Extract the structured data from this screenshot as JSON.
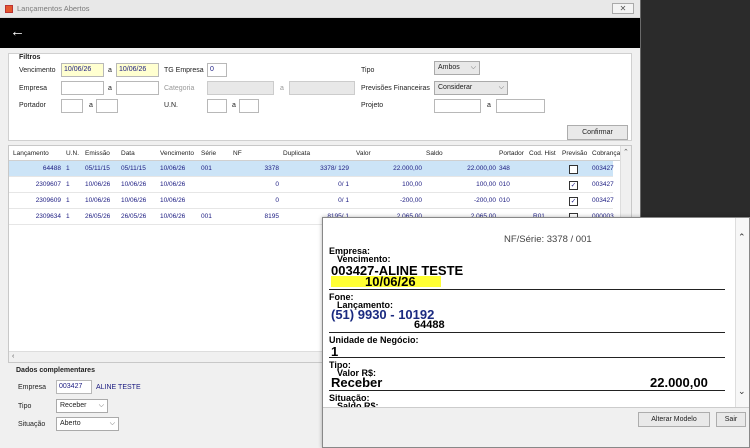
{
  "window": {
    "title": "Lançamentos Abertos"
  },
  "header": {
    "back_icon": "←"
  },
  "filters": {
    "group_title": "Filtros",
    "vencimento_label": "Vencimento",
    "vencimento_from": "10/06/26",
    "a": "a",
    "vencimento_to": "10/06/26",
    "tg_empresa_label": "TG Empresa",
    "tg_empresa_value": "0",
    "tipo_label": "Tipo",
    "tipo_value": "Ambos",
    "empresa_label": "Empresa",
    "categoria_label": "Categoria",
    "previsoes_label": "Previsões Financeiras",
    "previsoes_value": "Considerar",
    "portador_label": "Portador",
    "un_label": "U.N.",
    "projeto_label": "Projeto",
    "confirm_button": "Confirmar"
  },
  "grid": {
    "columns": [
      "Lançamento",
      "U.N.",
      "Emissão",
      "Data",
      "Vencimento",
      "Série",
      "NF",
      "Duplicata",
      "Valor",
      "Saldo",
      "Portador",
      "Cod. Hist",
      "Previsão",
      "Cobrança"
    ],
    "rows": [
      {
        "lancamento": "64488",
        "un": "1",
        "emissao": "05/11/15",
        "data": "05/11/15",
        "vencimento": "10/06/26",
        "serie": "001",
        "nf": "3378",
        "duplicata": "3378/ 129",
        "valor": "22.000,00",
        "saldo": "22.000,00",
        "portador": "348",
        "codhist": "",
        "previsao": "",
        "cobranca": "003427"
      },
      {
        "lancamento": "2309607",
        "un": "1",
        "emissao": "10/06/26",
        "data": "10/06/26",
        "vencimento": "10/06/26",
        "serie": "",
        "nf": "0",
        "duplicata": "0/ 1",
        "valor": "100,00",
        "saldo": "100,00",
        "portador": "010",
        "codhist": "",
        "previsao": "✓",
        "cobranca": "003427"
      },
      {
        "lancamento": "2309609",
        "un": "1",
        "emissao": "10/06/26",
        "data": "10/06/26",
        "vencimento": "10/06/26",
        "serie": "",
        "nf": "0",
        "duplicata": "0/ 1",
        "valor": "-200,00",
        "saldo": "-200,00",
        "portador": "010",
        "codhist": "",
        "previsao": "✓",
        "cobranca": "003427"
      },
      {
        "lancamento": "2309634",
        "un": "1",
        "emissao": "26/05/26",
        "data": "26/05/26",
        "vencimento": "10/06/26",
        "serie": "001",
        "nf": "8195",
        "duplicata": "8195/ 1",
        "valor": "2.065,00",
        "saldo": "2.065,00",
        "portador": "",
        "codhist": "R01",
        "previsao": "",
        "cobranca": "000003"
      }
    ]
  },
  "dados": {
    "group_title": "Dados complementares",
    "empresa_label": "Empresa",
    "empresa_code": "003427",
    "empresa_name": "ALINE TESTE",
    "tipo_label": "Tipo",
    "tipo_value": "Receber",
    "situacao_label": "Situação",
    "situacao_value": "Aberto"
  },
  "popup": {
    "title": "NF/Série: 3378 / 001",
    "empresa_label": "Empresa:",
    "vencimento_label": "Vencimento:",
    "empresa_value": "003427-ALINE TESTE",
    "vencimento_value": "10/06/26",
    "fone_label": "Fone:",
    "lancamento_label": "Lançamento:",
    "fone_value": "(51) 9930 - 10192",
    "lancamento_value": "64488",
    "un_label": "Unidade de Negócio:",
    "un_value": "1",
    "tipo_label": "Tipo:",
    "valor_label": "Valor R$:",
    "tipo_value": "Receber",
    "valor_value": "22.000,00",
    "situacao_label": "Situação:",
    "saldo_label": "Saldo R$:",
    "alterar_button": "Alterar Modelo",
    "sair_button": "Sair"
  }
}
